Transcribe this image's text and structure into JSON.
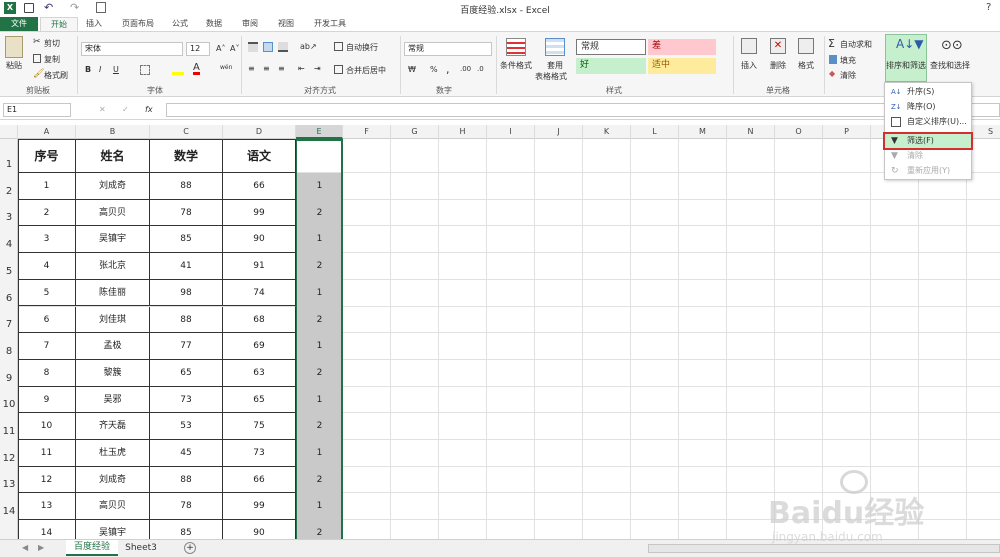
{
  "window": {
    "title": "百度经验.xlsx - Excel",
    "help": "?"
  },
  "tabs": [
    "文件",
    "开始",
    "插入",
    "页面布局",
    "公式",
    "数据",
    "审阅",
    "视图",
    "开发工具"
  ],
  "ribbon": {
    "clipboard": {
      "paste": "粘贴",
      "cut": "剪切",
      "copy": "复制",
      "format_painter": "格式刷",
      "label": "剪贴板"
    },
    "font": {
      "name": "宋体",
      "size": "12",
      "label": "字体",
      "bold": "B",
      "italic": "I",
      "underline": "U",
      "wen": "wén"
    },
    "alignment": {
      "wrap": "自动换行",
      "merge": "合并后居中",
      "label": "对齐方式"
    },
    "number": {
      "format": "常规",
      "percent": "%",
      "comma": ",",
      "label": "数字"
    },
    "styles": {
      "conditional": "条件格式",
      "table_format_1": "套用",
      "table_format_2": "表格格式",
      "normal": "常规",
      "bad": "差",
      "good": "好",
      "neutral": "适中",
      "label": "样式"
    },
    "cells": {
      "insert": "插入",
      "delete": "删除",
      "format": "格式",
      "label": "单元格"
    },
    "editing": {
      "autosum": "自动求和",
      "fill": "填充",
      "clear": "清除",
      "sort_filter": "排序和筛选",
      "find": "查找和选择"
    }
  },
  "formula_bar": {
    "name_box": "E1",
    "fx": "fx",
    "cancel": "✕",
    "confirm": "✓"
  },
  "columns": [
    "A",
    "B",
    "C",
    "D",
    "E",
    "F",
    "G",
    "H",
    "I",
    "J",
    "K",
    "L",
    "M",
    "N",
    "O",
    "P",
    "Q",
    "R",
    "S"
  ],
  "rows": [
    "1",
    "2",
    "3",
    "4",
    "5",
    "6",
    "7",
    "8",
    "9",
    "10",
    "11",
    "12",
    "13",
    "14"
  ],
  "table": {
    "headers": [
      "序号",
      "姓名",
      "数学",
      "语文"
    ],
    "data": [
      [
        "1",
        "刘成奇",
        "88",
        "66",
        "1"
      ],
      [
        "2",
        "高贝贝",
        "78",
        "99",
        "2"
      ],
      [
        "3",
        "吴镇宇",
        "85",
        "90",
        "1"
      ],
      [
        "4",
        "张北京",
        "41",
        "91",
        "2"
      ],
      [
        "5",
        "陈佳丽",
        "98",
        "74",
        "1"
      ],
      [
        "6",
        "刘佳琪",
        "88",
        "68",
        "2"
      ],
      [
        "7",
        "孟极",
        "77",
        "69",
        "1"
      ],
      [
        "8",
        "黎簇",
        "65",
        "63",
        "2"
      ],
      [
        "9",
        "吴邪",
        "73",
        "65",
        "1"
      ],
      [
        "10",
        "齐天磊",
        "53",
        "75",
        "2"
      ],
      [
        "11",
        "杜玉虎",
        "45",
        "73",
        "1"
      ],
      [
        "12",
        "刘成奇",
        "88",
        "66",
        "2"
      ],
      [
        "13",
        "高贝贝",
        "78",
        "99",
        "1"
      ],
      [
        "14",
        "吴镇宇",
        "85",
        "90",
        "2"
      ]
    ]
  },
  "dropdown": {
    "items": [
      {
        "label": "升序(S)",
        "enabled": true
      },
      {
        "label": "降序(O)",
        "enabled": true
      },
      {
        "label": "自定义排序(U)...",
        "enabled": true
      },
      {
        "label": "筛选(F)",
        "enabled": true,
        "highlighted": true
      },
      {
        "label": "清除",
        "enabled": false
      },
      {
        "label": "重新应用(Y)",
        "enabled": false
      }
    ]
  },
  "sheets": [
    "百度经验",
    "Sheet3"
  ],
  "add_sheet": "+",
  "watermark": {
    "brand": "Baidu经验",
    "url": "jingyan.baidu.com"
  },
  "colors": {
    "accent": "#217346",
    "highlight": "#c6efce",
    "bad_fill": "#ffc7ce",
    "neutral_fill": "#ffeb9c",
    "good_fill": "#c6efce",
    "selected_col": "#c9c9c9"
  }
}
